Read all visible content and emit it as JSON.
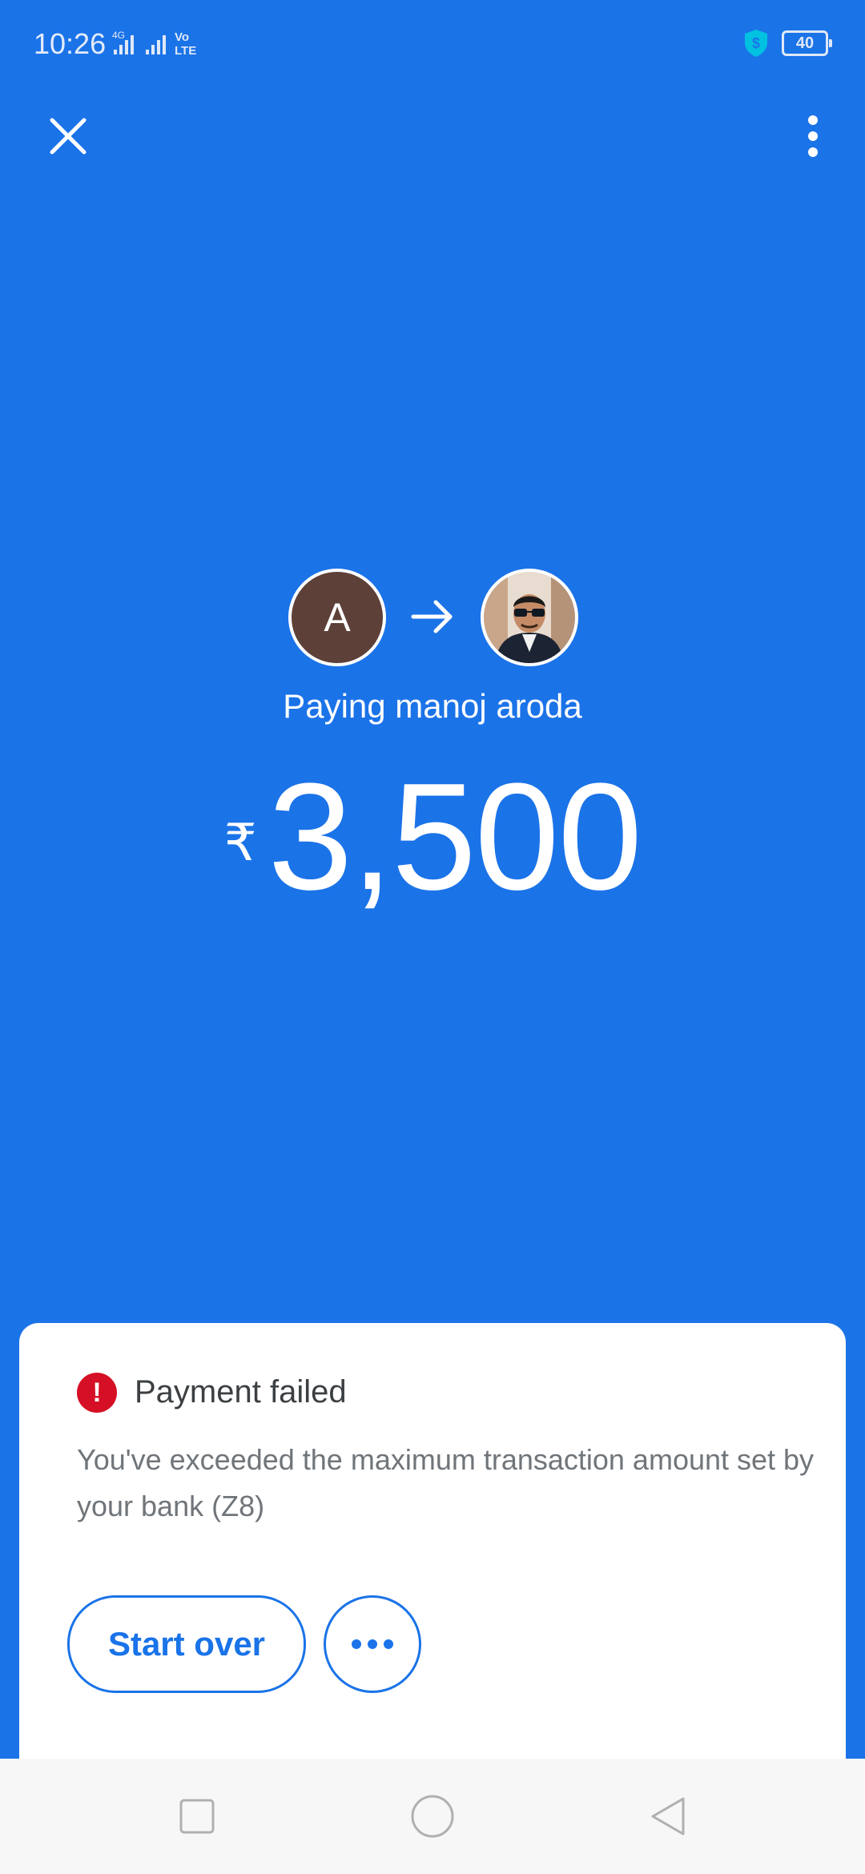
{
  "status_bar": {
    "time": "10:26",
    "network": "4G",
    "volte": "Vo LTE",
    "battery": "40"
  },
  "toolbar": {
    "close_icon": "close-icon",
    "more_icon": "more-vert-icon"
  },
  "transfer": {
    "payer_initial": "A",
    "payee_name_label": "Paying manoj aroda",
    "currency_symbol": "₹",
    "amount": "3,500",
    "colors": {
      "background": "#1b73e8",
      "payer_avatar": "#5d4037"
    }
  },
  "result_card": {
    "title": "Payment failed",
    "message": "You've exceeded the maximum transaction amount set by your bank (Z8)",
    "start_over_label": "Start over",
    "more_options_icon": "more-horiz-icon",
    "error_color": "#d50f25",
    "accent_color": "#1a73e8"
  },
  "nav_bar": {
    "recents_icon": "square-icon",
    "home_icon": "circle-icon",
    "back_icon": "triangle-back-icon"
  }
}
